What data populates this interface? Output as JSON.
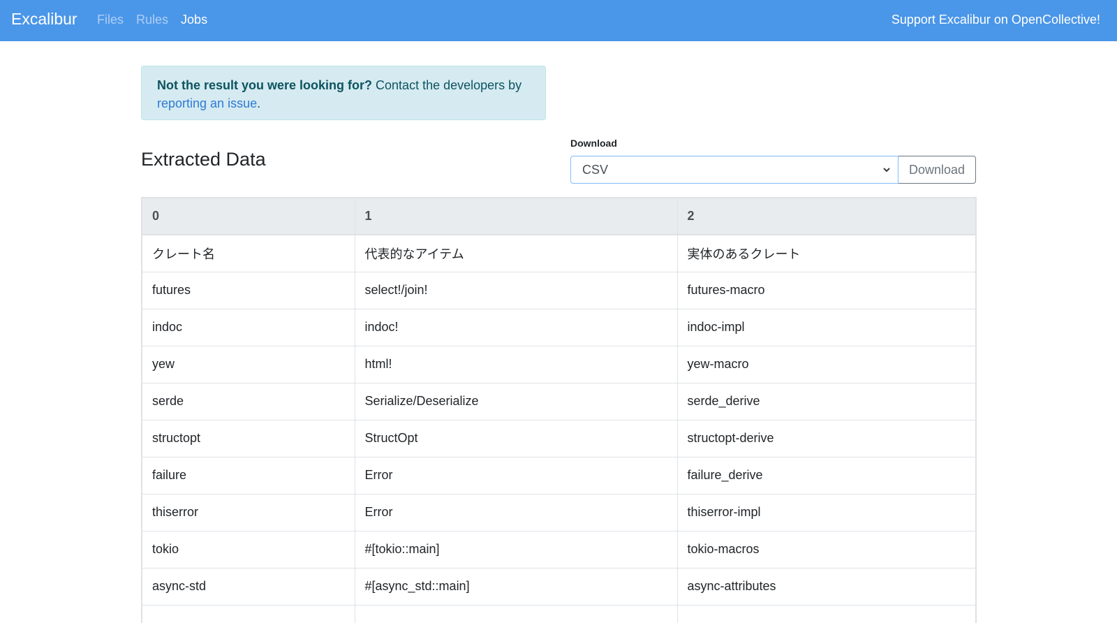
{
  "navbar": {
    "brand": "Excalibur",
    "links": [
      "Files",
      "Rules",
      "Jobs"
    ],
    "active_link": "Jobs",
    "support": "Support Excalibur on OpenCollective!"
  },
  "alert": {
    "strong": "Not the result you were looking for?",
    "text_before": " Contact the developers by ",
    "link": "reporting an issue",
    "text_after": "."
  },
  "section": {
    "title": "Extracted Data"
  },
  "download": {
    "label": "Download",
    "selected": "CSV",
    "button": "Download"
  },
  "table": {
    "headers": [
      "0",
      "1",
      "2"
    ],
    "rows": [
      [
        "クレート名",
        "代表的なアイテム",
        "実体のあるクレート"
      ],
      [
        "futures",
        "select!/join!",
        "futures-macro"
      ],
      [
        "indoc",
        "indoc!",
        "indoc-impl"
      ],
      [
        "yew",
        "html!",
        "yew-macro"
      ],
      [
        "serde",
        "Serialize/Deserialize",
        "serde_derive"
      ],
      [
        "structopt",
        "StructOpt",
        "structopt-derive"
      ],
      [
        "failure",
        "Error",
        "failure_derive"
      ],
      [
        "thiserror",
        "Error",
        "thiserror-impl"
      ],
      [
        "tokio",
        "#[tokio::main]",
        "tokio-macros"
      ],
      [
        "async-std",
        "#[async_std::main]",
        "async-attributes"
      ],
      [
        "",
        "",
        ""
      ]
    ]
  },
  "colors": {
    "navbar": "#4a96e8",
    "alert_bg": "#d6eaf1",
    "link": "#2b7bd6"
  }
}
